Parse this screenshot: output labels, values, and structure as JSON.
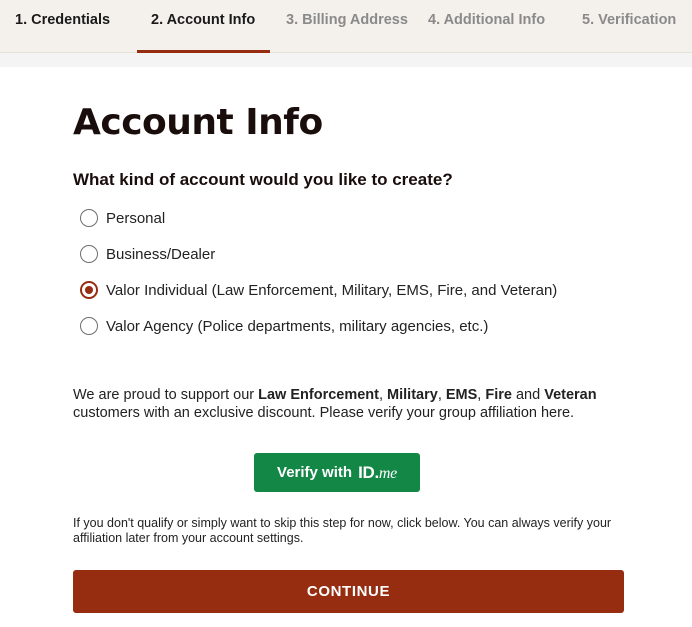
{
  "steps": [
    {
      "label": "1. Credentials",
      "state": "complete"
    },
    {
      "label": "2. Account Info",
      "state": "active"
    },
    {
      "label": "3. Billing Address",
      "state": "disabled"
    },
    {
      "label": "4. Additional Info",
      "state": "disabled"
    },
    {
      "label": "5. Verification",
      "state": "disabled"
    }
  ],
  "page": {
    "title": "Account Info",
    "question": "What kind of account would you like to create?"
  },
  "account_types": {
    "selected": "Valor Individual (Law Enforcement, Military, EMS, Fire, and Veteran)",
    "options": [
      {
        "label": "Personal",
        "checked": false
      },
      {
        "label": "Business/Dealer",
        "checked": false
      },
      {
        "label": "Valor Individual (Law Enforcement, Military, EMS, Fire, and Veteran)",
        "checked": true
      },
      {
        "label": "Valor Agency (Police departments, military agencies, etc.)",
        "checked": false
      }
    ]
  },
  "support": {
    "intro": "We are proud to support our ",
    "group1": "Law Enforcement",
    "sep1": ", ",
    "group2": "Military",
    "sep2": ", ",
    "group3": "EMS",
    "sep3": ", ",
    "group4": "Fire",
    "sep4": " and ",
    "group5": "Veteran",
    "outro": " customers with an exclusive discount. Please verify your group affiliation here."
  },
  "verify": {
    "label": "Verify with",
    "logo_id": "ID.",
    "logo_me": "me"
  },
  "skip_text": "If you don't qualify or simply want to skip this step for now, click below. You can always verify your affiliation later from your account settings.",
  "continue_label": "CONTINUE",
  "colors": {
    "brand": "#962d10",
    "verify_green": "#138746",
    "stepper_bg": "#f4f1ec"
  }
}
